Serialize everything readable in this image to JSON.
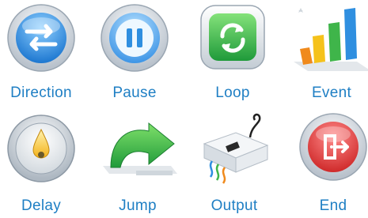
{
  "toolbox": {
    "items": [
      {
        "label": "Direction",
        "icon": "swap-arrows-icon"
      },
      {
        "label": "Pause",
        "icon": "pause-icon"
      },
      {
        "label": "Loop",
        "icon": "loop-icon"
      },
      {
        "label": "Event",
        "icon": "bar-chart-icon"
      },
      {
        "label": "Delay",
        "icon": "timer-icon"
      },
      {
        "label": "Jump",
        "icon": "jump-arrow-icon"
      },
      {
        "label": "Output",
        "icon": "output-device-icon"
      },
      {
        "label": "End",
        "icon": "exit-icon"
      }
    ]
  },
  "colors": {
    "label": "#1f7fc4",
    "blue": "#2f8fe0",
    "green": "#2fb34a",
    "red": "#e03b3b",
    "orange": "#f08a1c"
  }
}
